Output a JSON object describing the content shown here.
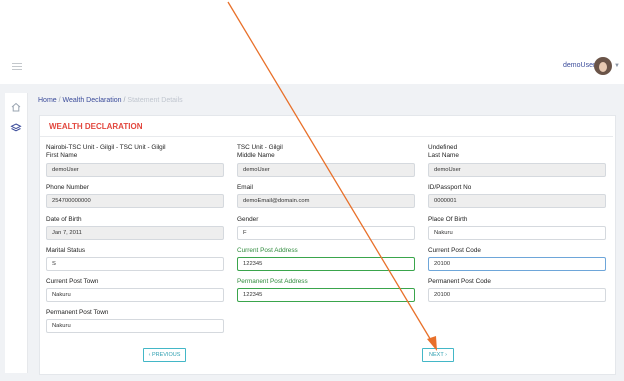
{
  "header": {
    "user_name": "demoUser",
    "icon": "hamburger-icon"
  },
  "breadcrumb": {
    "home": "Home",
    "wealth": "Wealth Declaration",
    "statement": "Statement Details",
    "sep": "/"
  },
  "form": {
    "title": "WEALTH DECLARATION",
    "first_name": {
      "pre": "Nairobi-TSC Unit - Gilgil - TSC Unit - Gilgil",
      "label": "First Name",
      "value": "demoUser"
    },
    "middle_name": {
      "pre": "TSC Unit - Gilgil",
      "label": "Middle Name",
      "value": "demoUser"
    },
    "last_name": {
      "pre": "Undefined",
      "label": "Last Name",
      "value": "demoUser"
    },
    "phone": {
      "label": "Phone Number",
      "value": "254700000000"
    },
    "email": {
      "label": "Email",
      "value": "demoEmail@domain.com"
    },
    "id_passport": {
      "label": "ID/Passport No",
      "value": "0000001"
    },
    "dob": {
      "label": "Date of Birth",
      "value": "Jan 7, 2011"
    },
    "gender": {
      "label": "Gender",
      "value": "F"
    },
    "place_of_birth": {
      "label": "Place Of Birth",
      "value": "Nakuru"
    },
    "marital_status": {
      "label": "Marital Status",
      "value": "S"
    },
    "current_post_address": {
      "label": "Current Post Address",
      "value": "122345"
    },
    "current_post_code": {
      "label": "Current Post Code",
      "value": "20100"
    },
    "current_post_town": {
      "label": "Current Post Town",
      "value": "Nakuru"
    },
    "permanent_post_address": {
      "label": "Permanent Post Address",
      "value": "122345"
    },
    "permanent_post_code": {
      "label": "Permanent Post Code",
      "value": "20100"
    },
    "permanent_post_town": {
      "label": "Permanent Post Town",
      "value": "Nakuru"
    },
    "previous_label": "‹ PREVIOUS",
    "next_label": "NEXT ›"
  },
  "colors": {
    "accent": "#3a4b9a",
    "title_red": "#e2473e",
    "green": "#2f8b3c",
    "button_teal": "#2e9fb0",
    "arrow": "#e8702a"
  }
}
